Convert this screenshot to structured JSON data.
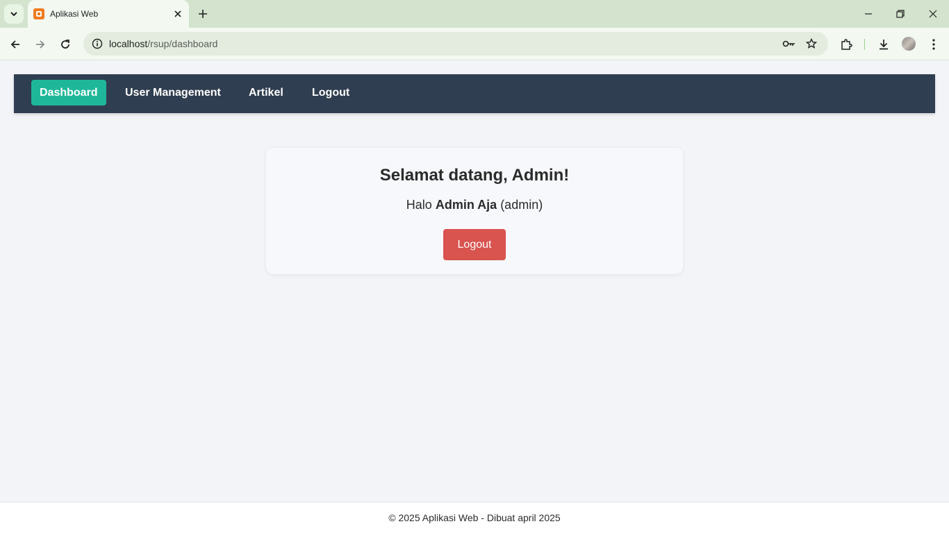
{
  "browser": {
    "tab_title": "Aplikasi Web",
    "url_host": "localhost",
    "url_path": "/rsup/dashboard"
  },
  "nav": {
    "items": [
      {
        "label": "Dashboard",
        "active": true
      },
      {
        "label": "User Management",
        "active": false
      },
      {
        "label": "Artikel",
        "active": false
      },
      {
        "label": "Logout",
        "active": false
      }
    ]
  },
  "card": {
    "title": "Selamat datang, Admin!",
    "greet_prefix": "Halo",
    "user_name": "Admin Aja",
    "user_role": "(admin)",
    "logout_label": "Logout"
  },
  "footer": {
    "text": "© 2025 Aplikasi Web - Dibuat april 2025"
  },
  "colors": {
    "navbar_bg": "#2f3e50",
    "active_nav": "#1fb799",
    "logout_button": "#d9534f",
    "page_bg": "#f3f4f8"
  }
}
